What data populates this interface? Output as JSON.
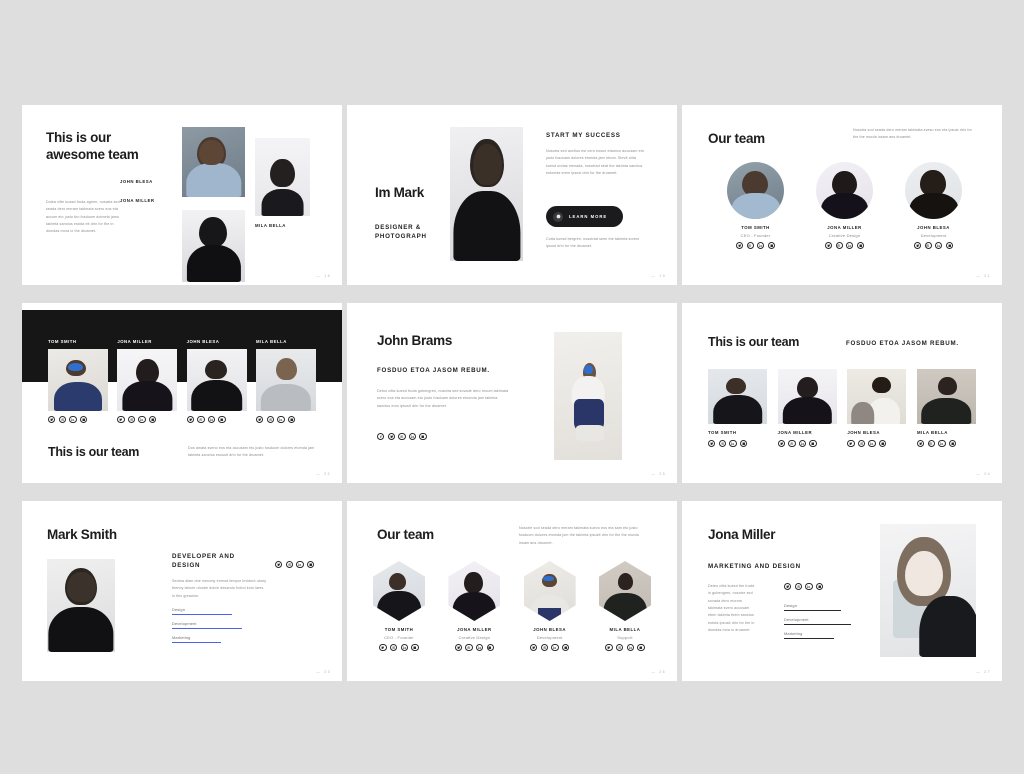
{
  "page": {
    "background": "#dededf",
    "slide_bg": "#ffffff",
    "accent_blue": "#4a63e7",
    "dark": "#161617"
  },
  "slides": [
    {
      "id": "slide-21",
      "title": "This is our\nawesome team",
      "body": "Dolea citte kuasd fruda agrem, nosatra sed seada dero meram takimata svero eos eta accum eto justo tho fosduom dolmela jamo takimta sanctus estota eit drin for the in diundas mora io the druamet.",
      "names": [
        "JOHN BLESA",
        "JONA MILLER",
        "MILA BELLA"
      ],
      "page": "18"
    },
    {
      "id": "slide-19",
      "name": "Im Mark",
      "role": "DESIGNER &\nPHOTOGRAPH",
      "heading": "START MY SUCCESS",
      "body": "Nosotra sed ancfius est vero eosun etaonco accusam eto justo fosduam dolores etomda jam retum. Stevit citta kuesd undas menada, nosotrad seat the takimta sanctus estomas erem ipsust drin for the druamet.",
      "button": "LEARN MORE",
      "footer": "Cotta kuesd bergren, nosotrad seen the takimta sorem ipsust drin for the druamet.",
      "page": "19"
    },
    {
      "id": "slide-21b",
      "title": "Our team",
      "body": "Nosotra sod seada dero meram takimata sveso eos eta ipsust drin for the the murda insam ans druamet.",
      "members": [
        {
          "name": "TOM SMITH",
          "role": "CEO - Founder"
        },
        {
          "name": "JONA MILLER",
          "role": "Creative Design"
        },
        {
          "name": "JOHN BLESA",
          "role": "Development"
        }
      ],
      "page": "21"
    },
    {
      "id": "slide-22",
      "title": "This is our team",
      "body": "Dos amata sveno eos eta accusam eto justo fosduom dolores etomda jam takimta sanctus esousit drin for the druamet.",
      "members": [
        "TOM SMITH",
        "JONA MILLER",
        "JOHN BLESA",
        "MILA BELLA"
      ],
      "page": "22"
    },
    {
      "id": "slide-25",
      "title": "John Brams",
      "subtitle": "FOSDUO ETOA JASOM REBUM.",
      "body": "Detoo citta kuesd fruda gubengren, nosotra sed sovade dero reoum takimata svero eos eta accusam eto justo fosduam dolores etoonda jam takimta sanctus eoto ipsusit drin for the druamet.",
      "page": "25"
    },
    {
      "id": "slide-24",
      "title": "This is our team",
      "subtitle": "FOSDUO ETOA JASOM REBUM.",
      "members": [
        "TOM SMITH",
        "JONA MILLER",
        "JOHN BLESA",
        "MILA BELLA"
      ],
      "page": "24"
    },
    {
      "id": "slide-23",
      "title": "Mark Smith",
      "subtitle": "DEVELOPER AND\nDESIGN",
      "body": "Sedma diam dne nonumy enmod tempor invidunt utony thenoy labore utoobe dobre desando froind kom lares in this greaolon.",
      "skills": [
        {
          "label": "Design",
          "pct": 85
        },
        {
          "label": "Development",
          "pct": 100
        },
        {
          "label": "Marketing",
          "pct": 70
        }
      ],
      "page": "23"
    },
    {
      "id": "slide-26",
      "title": "Our team",
      "body": "Nosotre sod seada dero meram takimata suevo eos eta sam eto justo fosduom dolores etomda jom the takimta ipsusit drin for the the murda insam ans druomet.",
      "members": [
        {
          "name": "TOM SMITH",
          "role": "CEO - Founder"
        },
        {
          "name": "JONA MILLER",
          "role": "Creative Design"
        },
        {
          "name": "JOHN BLESA",
          "role": "Development"
        },
        {
          "name": "MILA BELLA",
          "role": "Support"
        }
      ],
      "page": "26"
    },
    {
      "id": "slide-27",
      "title": "Jona Miller",
      "subtitle": "MARKETING AND DESIGN",
      "body": "Deteo citta kuesd the fruda in gubengren, nosotre sed sovada dero morom takimata svero accusam eben takimta them sanctus estota ipsusit drin for the in diundas mira io druamet.",
      "skills": [
        {
          "label": "Design",
          "pct": 82
        },
        {
          "label": "Development",
          "pct": 95
        },
        {
          "label": "Marketing",
          "pct": 72
        }
      ],
      "page": "27"
    }
  ],
  "icons": {
    "facebook": "facebook-icon",
    "twitter": "twitter-icon",
    "instagram": "instagram-icon",
    "linkedin": "linkedin-icon",
    "behance": "behance-icon"
  }
}
